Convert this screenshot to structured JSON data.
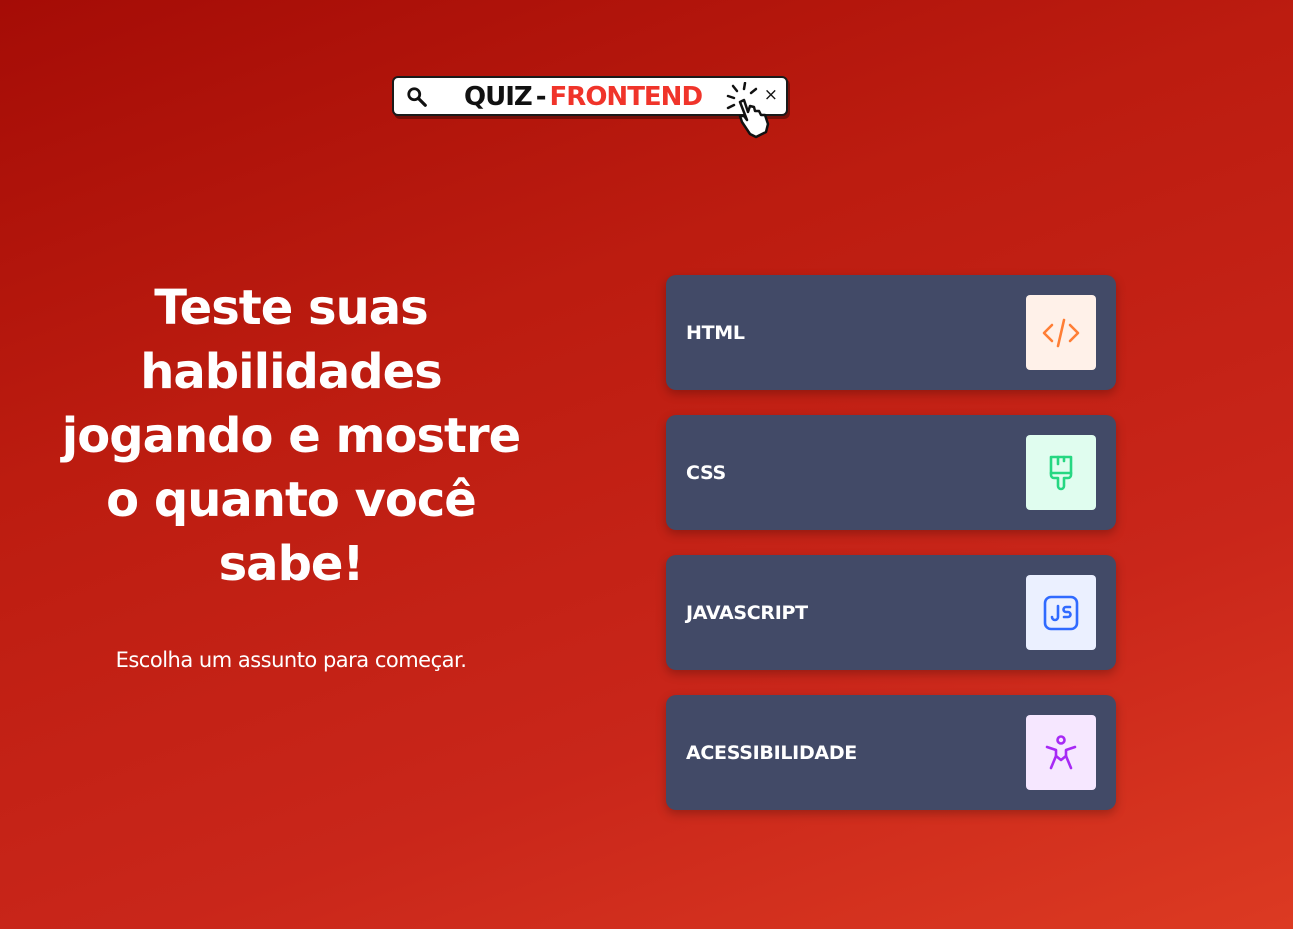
{
  "logo": {
    "word1": "QUIZ",
    "separator": "-",
    "word2": "FRONTEND",
    "close_symbol": "×",
    "icons": [
      "search-icon",
      "click-icon",
      "close-icon"
    ]
  },
  "hero": {
    "headline": "Teste suas habilidades jogando e mostre o quanto você sabe!",
    "subtitle": "Escolha um assunto para começar."
  },
  "subjects": [
    {
      "label": "HTML",
      "icon": "code-icon",
      "icon_color": "#ff7e35",
      "icon_bg": "#fff1e9"
    },
    {
      "label": "CSS",
      "icon": "paintbrush-icon",
      "icon_color": "#26d782",
      "icon_bg": "#e0fdef"
    },
    {
      "label": "JAVASCRIPT",
      "icon": "js-icon",
      "icon_color": "#306aff",
      "icon_bg": "#ebf0ff"
    },
    {
      "label": "ACESSIBILIDADE",
      "icon": "accessibility-icon",
      "icon_color": "#a729f5",
      "icon_bg": "#f6e7ff"
    }
  ],
  "colors": {
    "background_start": "#a50c06",
    "background_end": "#dc3a22",
    "card": "#424a67",
    "accent": "#f0342a"
  }
}
